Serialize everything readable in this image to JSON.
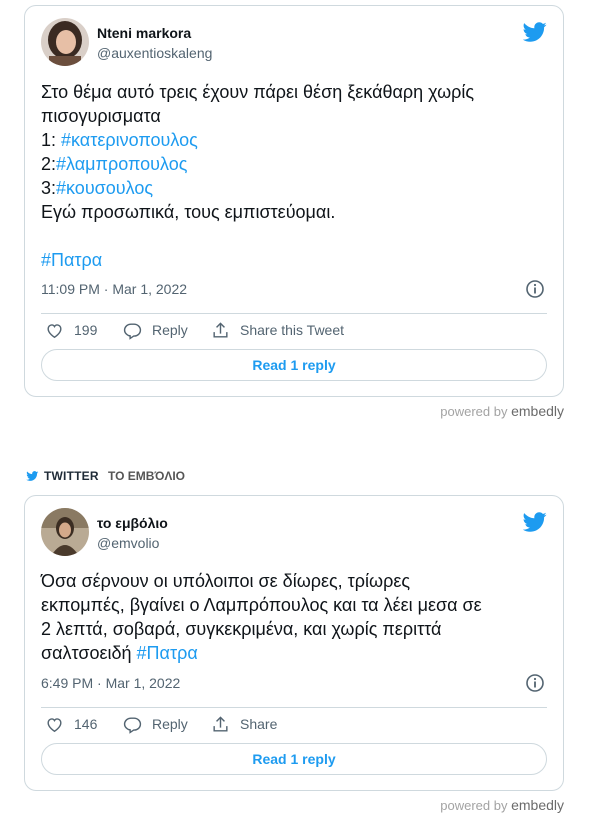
{
  "tweets": [
    {
      "author_name": "Nteni markora",
      "author_handle": "@auxentioskaleng",
      "text_line1": "Στο θέμα αυτό τρεις έχουν πάρει θέση ξεκάθαρη χωρίς",
      "text_line2": "πισογυρισματα",
      "list_prefix_1": "1: ",
      "hashtag_1": "#κατερινοπουλος",
      "list_prefix_2": "2:",
      "hashtag_2": "#λαμπροπουλος",
      "list_prefix_3": "3:",
      "hashtag_3": "#κουσουλος",
      "text_line6": "Εγώ προσωπικά, τους εμπιστεύομαι.",
      "hashtag_final": "#Πατρα",
      "timestamp": "11:09 PM · Mar 1, 2022",
      "likes": "199",
      "reply_label": "Reply",
      "share_label": "Share this Tweet",
      "read_replies": "Read 1 reply"
    },
    {
      "author_name": "το εμβόλιο",
      "author_handle": "@emvolio",
      "text_line1": "Όσα σέρνουν οι υπόλοιποι σε δίωρες, τρίωρες",
      "text_line2": "εκπομπές, βγαίνει ο Λαμπρόπουλος και τα λέει μεσα σε",
      "text_line3": "2 λεπτά, σοβαρά, συγκεκριμένα, και χωρίς περιττά",
      "text_line4_prefix": "σαλτσοειδή ",
      "hashtag_final": "#Πατρα",
      "timestamp": "6:49 PM · Mar 1, 2022",
      "likes": "146",
      "reply_label": "Reply",
      "share_label": "Share",
      "read_replies": "Read 1 reply"
    }
  ],
  "embed": {
    "powered_by": "powered by",
    "brand": "embedly"
  },
  "source": {
    "label": "TWITTER",
    "name": "ΤΟ ΕΜΒΌΛΙΟ"
  },
  "colors": {
    "accent": "#1d9bf0",
    "text": "#0f1419",
    "muted": "#536471",
    "border": "#cfd9de"
  }
}
